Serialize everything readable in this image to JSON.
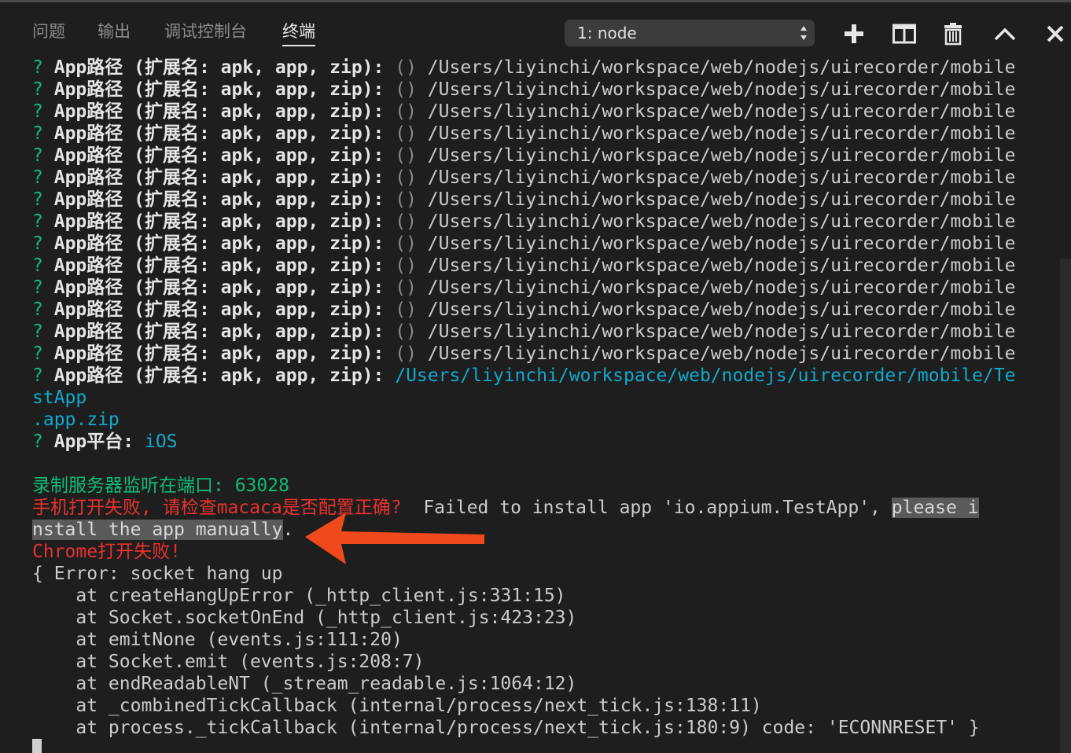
{
  "panel": {
    "tabs": [
      {
        "label": "问题"
      },
      {
        "label": "输出"
      },
      {
        "label": "调试控制台"
      },
      {
        "label": "终端"
      }
    ],
    "active_tab": "终端",
    "terminal_select": "1: node"
  },
  "colors": {
    "background": "#1e1e1e",
    "prompt_green": "#0dbc79",
    "cyan": "#11a8cd",
    "error_red": "#e8322e",
    "selection": "#5a5a5a",
    "annotation_arrow": "#f04a1c"
  },
  "icons": [
    "plus-icon",
    "split-icon",
    "trash-icon",
    "chevron-up-icon",
    "close-icon"
  ],
  "terminal": {
    "prompt_mark": "?",
    "prompt_label": "App路径 (扩展名: apk, app, zip):",
    "radio_mark": "()",
    "repeated_path": "/Users/liyinchi/workspace/web/nodejs/uirecorder/mobile",
    "final_path_1": "/Users/liyinchi/workspace/web/nodejs/uirecorder/mobile/Te",
    "final_path_2": "stApp",
    "final_path_3": ".app.zip",
    "platform_label": "App平台:",
    "platform_value": "iOS",
    "server_line": "录制服务器监听在端口: 63028",
    "phone_error": "手机打开失败, 请检查macaca是否配置正确?",
    "install_msg": "  Failed to install app 'io.appium.TestApp', ",
    "install_sel_1": "please i",
    "install_sel_2": "nstall the app manually",
    "install_end": ".",
    "chrome_error": "Chrome打开失败!",
    "error_head": "{ Error: socket hang up",
    "stack": [
      "    at createHangUpError (_http_client.js:331:15)",
      "    at Socket.socketOnEnd (_http_client.js:423:23)",
      "    at emitNone (events.js:111:20)",
      "    at Socket.emit (events.js:208:7)",
      "    at endReadableNT (_stream_readable.js:1064:12)",
      "    at _combinedTickCallback (internal/process/next_tick.js:138:11)",
      "    at process._tickCallback (internal/process/next_tick.js:180:9) code: 'ECONNRESET' }"
    ]
  }
}
